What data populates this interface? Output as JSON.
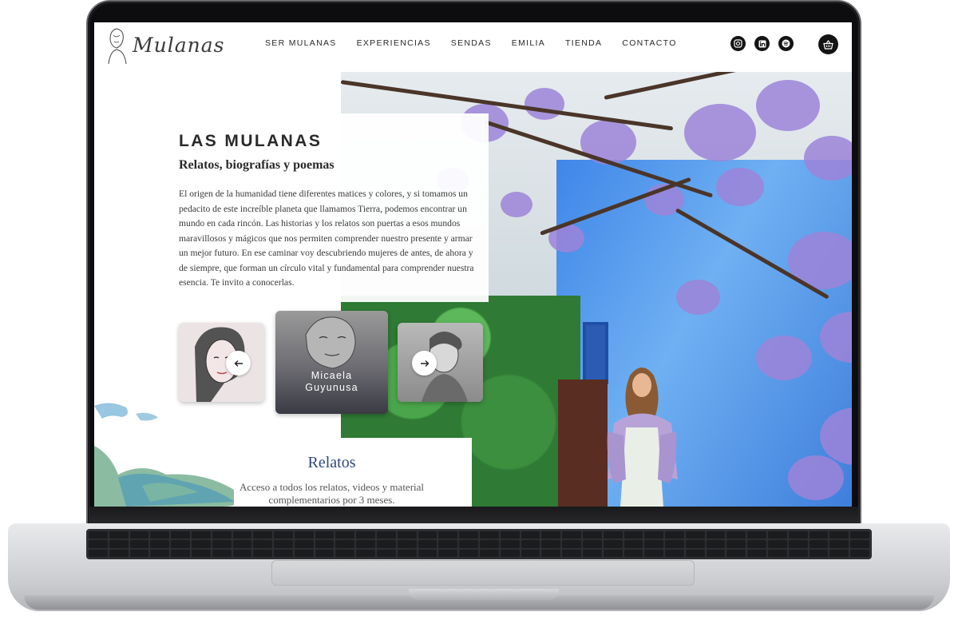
{
  "brand": {
    "logo_text": "Mulanas"
  },
  "nav": {
    "items": [
      "SER MULANAS",
      "EXPERIENCIAS",
      "SENDAS",
      "EMILIA",
      "TIENDA",
      "CONTACTO"
    ]
  },
  "social": {
    "icons": [
      "instagram-icon",
      "linkedin-icon",
      "spotify-icon"
    ]
  },
  "cart": {
    "icon": "basket-icon"
  },
  "hero": {
    "title": "LAS MULANAS",
    "subtitle": "Relatos, biografías y poemas",
    "paragraph": "El origen de la humanidad tiene diferentes matices y colores, y si tomamos un pedacito de este increíble planeta que llamamos Tierra, podemos encontrar un mundo en cada rincón. Las historias y los relatos son puertas a esos mundos maravillosos y mágicos que nos permiten comprender nuestro presente y armar un mejor futuro. En ese caminar voy descubriendo mujeres de antes, de ahora y de siempre, que forman un círculo vital y fundamental para comprender nuestra esencia. Te invito a conocerlas."
  },
  "carousel": {
    "active_card_name": "Micaela\nGuyunusa",
    "prev_icon": "arrow-left-icon",
    "next_icon": "arrow-right-icon"
  },
  "relatos": {
    "title": "Relatos",
    "text": "Acceso a todos los relatos, videos y material complementarios por 3 meses."
  },
  "colors": {
    "text_dark": "#2a2a2a",
    "relatos_blue": "#2f4a78",
    "icon_bg": "#141414",
    "blossom": "#9c84d8",
    "wall_blue": "#3f86e8"
  }
}
